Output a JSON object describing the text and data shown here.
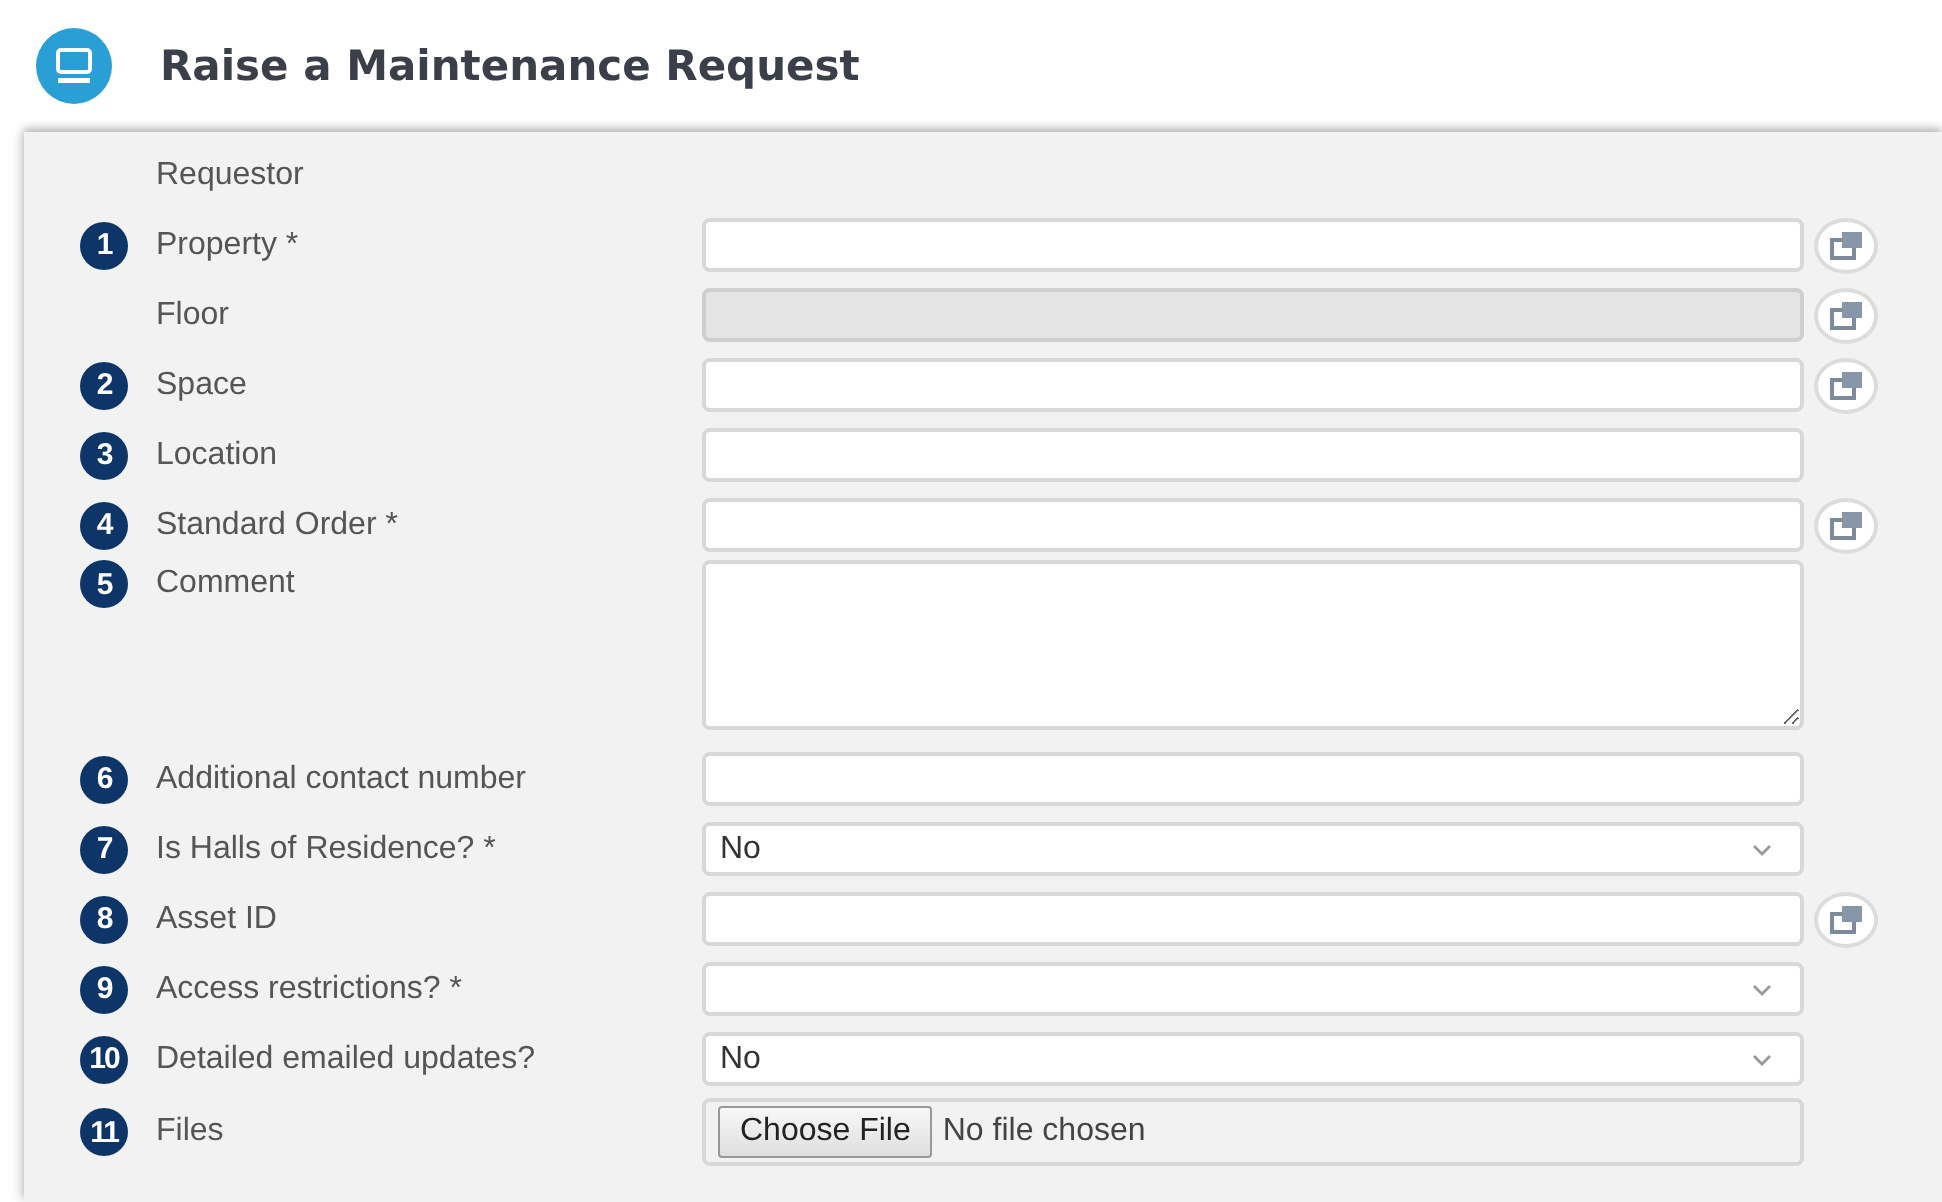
{
  "header": {
    "title": "Raise a Maintenance Request"
  },
  "fields": [
    {
      "kind": "none",
      "label": "Requestor"
    },
    {
      "kind": "text",
      "step": "1",
      "label": "Property *",
      "disabled": false,
      "lookup": true
    },
    {
      "kind": "text",
      "label": "Floor",
      "disabled": true,
      "lookup": true
    },
    {
      "kind": "text",
      "step": "2",
      "label": "Space",
      "disabled": false,
      "lookup": true
    },
    {
      "kind": "text",
      "step": "3",
      "label": "Location",
      "disabled": false,
      "lookup": false
    },
    {
      "kind": "text",
      "step": "4",
      "label": "Standard Order *",
      "disabled": false,
      "lookup": true
    },
    {
      "kind": "textarea",
      "step": "5",
      "label": "Comment"
    },
    {
      "kind": "text",
      "step": "6",
      "label": "Additional contact number",
      "disabled": false,
      "lookup": false
    },
    {
      "kind": "select",
      "step": "7",
      "label": "Is Halls of Residence? *",
      "value": "No"
    },
    {
      "kind": "text",
      "step": "8",
      "label": "Asset ID",
      "disabled": false,
      "lookup": true
    },
    {
      "kind": "select",
      "step": "9",
      "label": "Access restrictions? *"
    },
    {
      "kind": "select",
      "step": "10",
      "label": "Detailed emailed updates?",
      "value": "No"
    },
    {
      "kind": "file",
      "step": "11",
      "label": "Files",
      "button_label": "Choose File",
      "status": "No file chosen"
    }
  ]
}
